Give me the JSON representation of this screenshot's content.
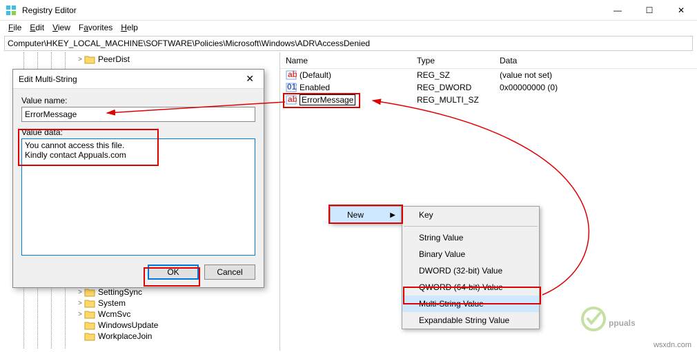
{
  "window": {
    "title": "Registry Editor",
    "controls": {
      "min": "—",
      "max": "☐",
      "close": "✕"
    }
  },
  "menu": {
    "file": "File",
    "edit": "Edit",
    "view": "View",
    "favorites": "Favorites",
    "help": "Help"
  },
  "address": "Computer\\HKEY_LOCAL_MACHINE\\SOFTWARE\\Policies\\Microsoft\\Windows\\ADR\\AccessDenied",
  "tree": {
    "visible_items": [
      {
        "label": "PeerDist",
        "indent": 110,
        "exp": ">"
      },
      {
        "label": "SettingSync",
        "indent": 110,
        "exp": ">"
      },
      {
        "label": "System",
        "indent": 110,
        "exp": ">"
      },
      {
        "label": "WcmSvc",
        "indent": 110,
        "exp": ">"
      },
      {
        "label": "WindowsUpdate",
        "indent": 110,
        "exp": " "
      },
      {
        "label": "WorkplaceJoin",
        "indent": 110,
        "exp": " "
      }
    ]
  },
  "list": {
    "headers": {
      "name": "Name",
      "type": "Type",
      "data": "Data"
    },
    "rows": [
      {
        "icon": "ab",
        "name": "(Default)",
        "type": "REG_SZ",
        "data": "(value not set)",
        "editing": false
      },
      {
        "icon": "011",
        "name": "Enabled",
        "type": "REG_DWORD",
        "data": "0x00000000 (0)",
        "editing": false
      },
      {
        "icon": "ab",
        "name": "ErrorMessage",
        "type": "REG_MULTI_SZ",
        "data": "",
        "editing": true
      }
    ]
  },
  "dialog": {
    "title": "Edit Multi-String",
    "valuename_label": "Value name:",
    "valuename": "ErrorMessage",
    "valuedata_label": "Value data:",
    "valuedata": "You cannot access this file.\nKindly contact Appuals.com",
    "ok": "OK",
    "cancel": "Cancel"
  },
  "context_menu": {
    "parent": {
      "new": "New"
    },
    "submenu": [
      {
        "label": "Key",
        "sep_after": true
      },
      {
        "label": "String Value"
      },
      {
        "label": "Binary Value"
      },
      {
        "label": "DWORD (32-bit) Value"
      },
      {
        "label": "QWORD (64-bit) Value"
      },
      {
        "label": "Multi-String Value",
        "highlight": true
      },
      {
        "label": "Expandable String Value"
      }
    ]
  },
  "watermark": "wsxdn.com",
  "brand_text": "Appuals"
}
